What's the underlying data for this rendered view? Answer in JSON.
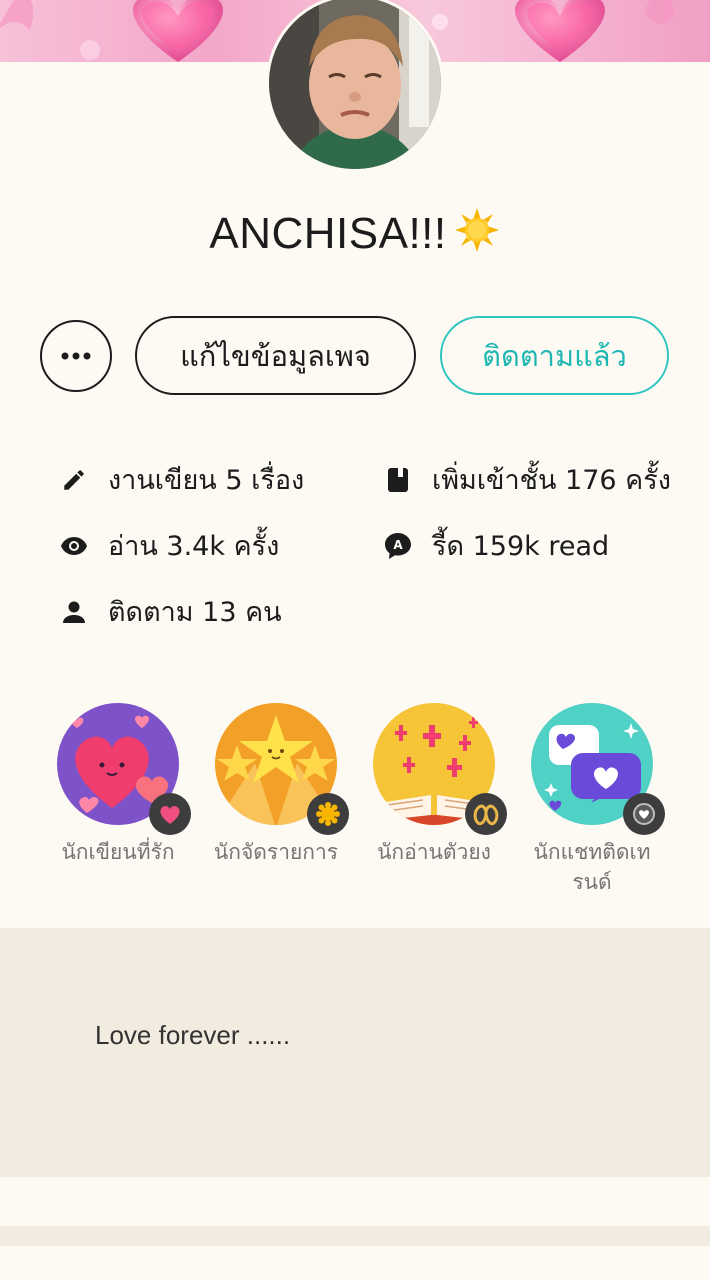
{
  "profile": {
    "name": "ANCHISA!!!",
    "name_emoji": "sun-emoji"
  },
  "actions": {
    "more_label": "⋯",
    "edit_label": "แก้ไขข้อมูลเพจ",
    "follow_label": "ติดตามแล้ว"
  },
  "stats": {
    "works": "งานเขียน 5 เรื่อง",
    "shelf": "เพิ่มเข้าชั้น 176 ครั้ง",
    "reads": "อ่าน 3.4k ครั้ง",
    "readers": "รี้ด 159k read",
    "following": "ติดตาม 13 คน"
  },
  "badges": [
    {
      "label": "นักเขียนที่รัก",
      "icon": "heart-badge-icon"
    },
    {
      "label": "นักจัดรายการ",
      "icon": "star-badge-icon"
    },
    {
      "label": "นักอ่านตัวยง",
      "icon": "book-badge-icon"
    },
    {
      "label": "นักแชทติดเทรนด์",
      "icon": "chat-badge-icon"
    }
  ],
  "bio": {
    "text": "Love forever ......"
  },
  "colors": {
    "accent": "#2ec4c0",
    "background": "#fdf9f3",
    "bio_background": "#f2ebe0"
  }
}
